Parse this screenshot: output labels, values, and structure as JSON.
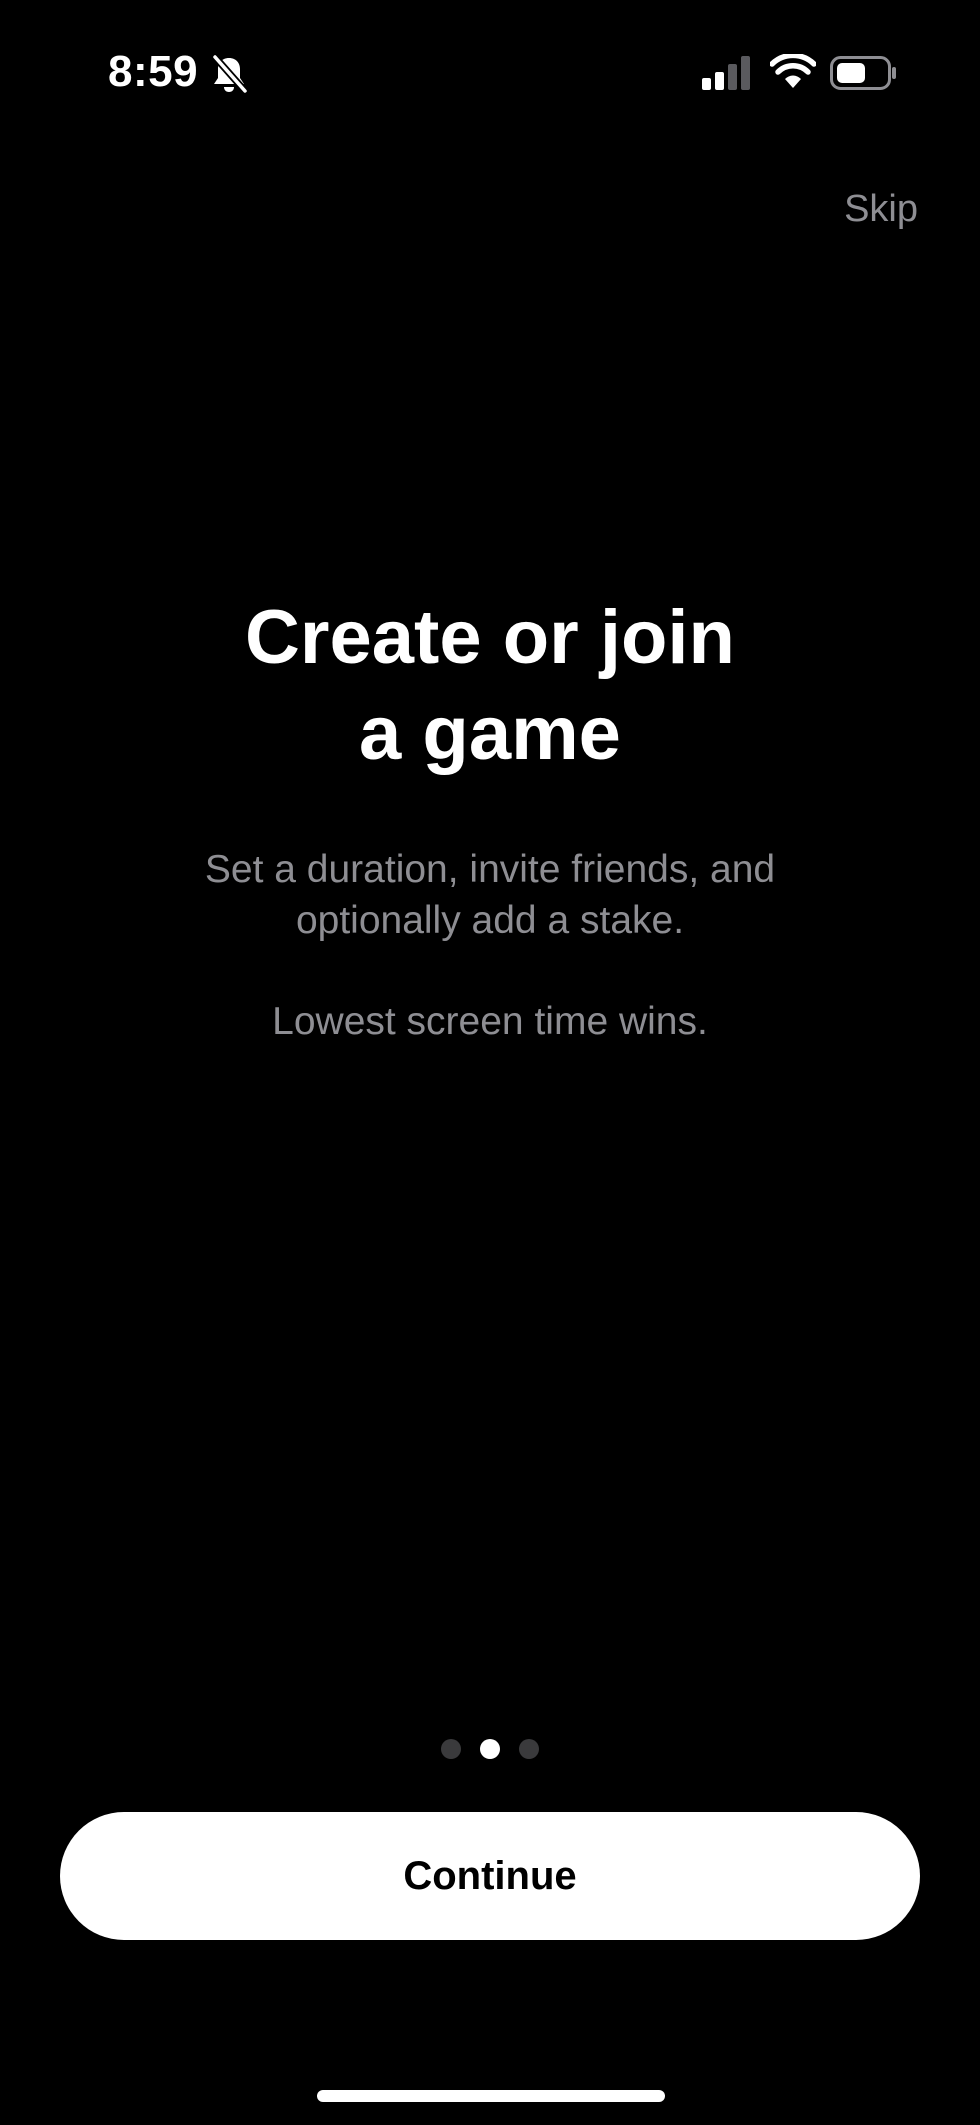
{
  "status_bar": {
    "time": "8:59",
    "icons": [
      "bell-slash-icon",
      "cellular-signal-icon",
      "wifi-icon",
      "battery-icon"
    ]
  },
  "onboarding": {
    "skip_label": "Skip",
    "title_line1": "Create or join",
    "title_line2": "a game",
    "description_line1": "Set a duration, invite friends, and",
    "description_line2": "optionally add a stake.",
    "tagline": "Lowest screen time wins.",
    "page_count": 3,
    "current_page": 2,
    "continue_label": "Continue"
  },
  "colors": {
    "background": "#000000",
    "primary_text": "#ffffff",
    "secondary_text": "#8e8e93",
    "inactive_dot": "#3a3a3c",
    "button_background": "#ffffff",
    "button_text": "#000000"
  }
}
